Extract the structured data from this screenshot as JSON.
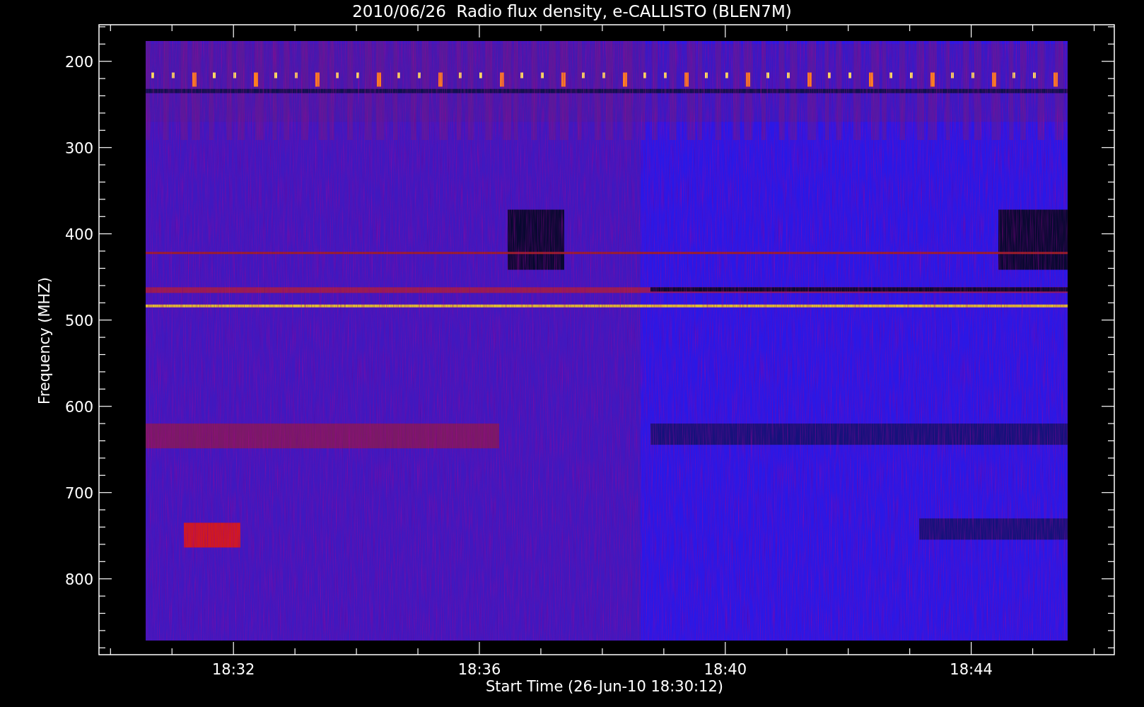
{
  "title": "2010/06/26  Radio flux density, e-CALLISTO (BLEN7M)",
  "x_axis": {
    "label": "Start Time (26-Jun-10 18:30:12)",
    "ticks": [
      "18:32",
      "18:36",
      "18:40",
      "18:44"
    ]
  },
  "y_axis": {
    "label": "Frequency (MHZ)",
    "ticks": [
      "200",
      "300",
      "400",
      "500",
      "600",
      "700",
      "800"
    ]
  }
}
